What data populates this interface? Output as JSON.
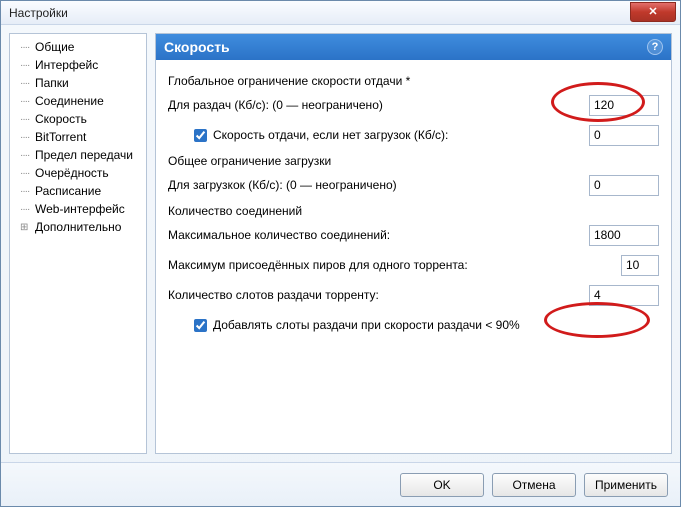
{
  "window": {
    "title": "Настройки",
    "close_glyph": "✕"
  },
  "sidebar": {
    "items": [
      {
        "label": "Общие"
      },
      {
        "label": "Интерфейс"
      },
      {
        "label": "Папки"
      },
      {
        "label": "Соединение"
      },
      {
        "label": "Скорость"
      },
      {
        "label": "BitTorrent"
      },
      {
        "label": "Предел передачи"
      },
      {
        "label": "Очерёдность"
      },
      {
        "label": "Расписание"
      },
      {
        "label": "Web-интерфейс"
      }
    ],
    "expandable": {
      "label": "Дополнительно",
      "glyph": "⊞"
    }
  },
  "header": {
    "title": "Скорость",
    "help": "?"
  },
  "form": {
    "upload": {
      "group": "Глобальное ограничение скорости отдачи *",
      "rate_label": "Для раздач (Кб/с): (0 — неограничено)",
      "rate_value": "120",
      "alt_label": "Скорость отдачи, если нет загрузок (Кб/с):",
      "alt_value": "0"
    },
    "download": {
      "group": "Общее ограничение загрузки",
      "rate_label": "Для загрузкок (Кб/с): (0 — неограничено)",
      "rate_value": "0"
    },
    "conn": {
      "group": "Количество соединений",
      "max_global_label": "Максимальное количество соединений:",
      "max_global_value": "1800",
      "max_peers_label": "Максимум присоедённых пиров для одного торрента:",
      "max_peers_value": "10",
      "slots_label": "Количество слотов раздачи торренту:",
      "slots_value": "4",
      "add_slots_label": "Добавлять слоты раздачи при скорости раздачи < 90%"
    }
  },
  "footer": {
    "ok": "OK",
    "cancel": "Отмена",
    "apply": "Применить"
  }
}
